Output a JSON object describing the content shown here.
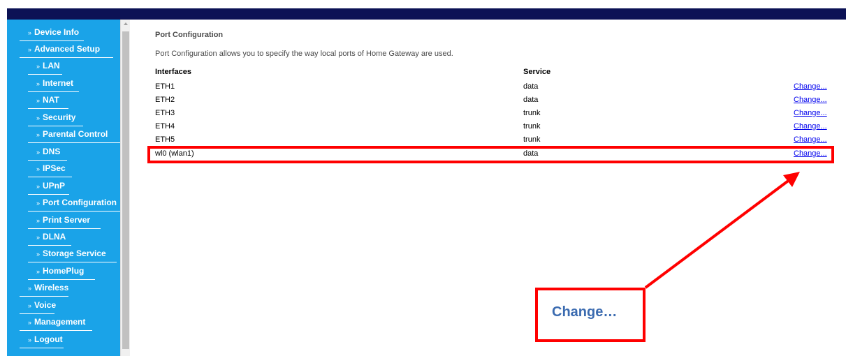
{
  "sidebar": {
    "items": [
      {
        "label": "Device Info",
        "level": 0
      },
      {
        "label": "Advanced Setup",
        "level": 0
      },
      {
        "label": "LAN",
        "level": 1
      },
      {
        "label": "Internet",
        "level": 1
      },
      {
        "label": "NAT",
        "level": 1
      },
      {
        "label": "Security",
        "level": 1
      },
      {
        "label": "Parental Control",
        "level": 1
      },
      {
        "label": "DNS",
        "level": 1
      },
      {
        "label": "IPSec",
        "level": 1
      },
      {
        "label": "UPnP",
        "level": 1
      },
      {
        "label": "Port Configuration",
        "level": 1
      },
      {
        "label": "Print Server",
        "level": 1
      },
      {
        "label": "DLNA",
        "level": 1
      },
      {
        "label": "Storage Service",
        "level": 1
      },
      {
        "label": "HomePlug",
        "level": 1
      },
      {
        "label": "Wireless",
        "level": 0
      },
      {
        "label": "Voice",
        "level": 0
      },
      {
        "label": "Management",
        "level": 0
      },
      {
        "label": "Logout",
        "level": 0
      }
    ],
    "bullet": "»"
  },
  "main": {
    "title": "Port Configuration",
    "description": "Port Configuration allows you to specify the way local ports of Home Gateway are used.",
    "columns": {
      "interfaces": "Interfaces",
      "service": "Service"
    },
    "rows": [
      {
        "interface": "ETH1",
        "service": "data",
        "action": "Change..."
      },
      {
        "interface": "ETH2",
        "service": "data",
        "action": "Change..."
      },
      {
        "interface": "ETH3",
        "service": "trunk",
        "action": "Change..."
      },
      {
        "interface": "ETH4",
        "service": "trunk",
        "action": "Change..."
      },
      {
        "interface": "ETH5",
        "service": "trunk",
        "action": "Change..."
      },
      {
        "interface": "wl0 (wlan1)",
        "service": "data",
        "action": "Change..."
      }
    ]
  },
  "annotation": {
    "callout_label": "Change…",
    "color": "#ff0000"
  },
  "colors": {
    "topbar": "#0c1255",
    "sidebar": "#1aa3e8",
    "link": "#0000ee",
    "callout_text": "#3b6bb0"
  }
}
